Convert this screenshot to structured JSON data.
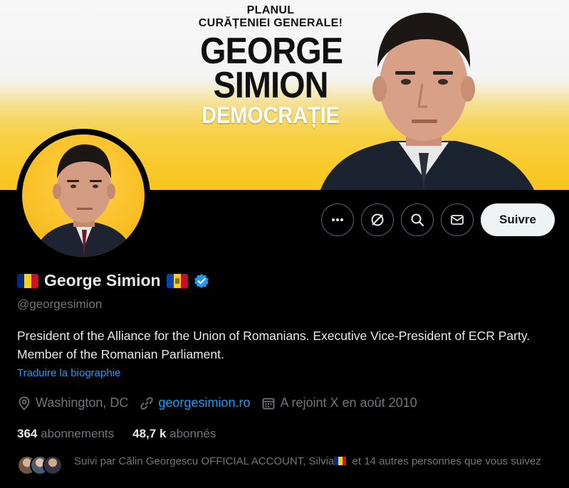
{
  "banner": {
    "line1": "PLANUL",
    "line2": "CURĂȚENIEI GENERALE!",
    "name1": "GEORGE",
    "name2": "SIMION",
    "slogan": "DEMOCRAȚIE"
  },
  "actions": {
    "more_icon": "more-horizontal-icon",
    "grok_icon": "grok-icon",
    "search_icon": "search-icon",
    "message_icon": "envelope-icon",
    "follow_label": "Suivre"
  },
  "profile": {
    "display_name": "George Simion",
    "handle": "@georgesimion",
    "verified": true,
    "bio": "President of the Alliance for the Union of Romanians. Executive Vice-President of ECR Party. Member of the Romanian Parliament.",
    "translate_label": "Traduire la biographie",
    "location": "Washington, DC",
    "website": "georgesimion.ro",
    "joined": "A rejoint X en août 2010",
    "following_count": "364",
    "following_label": "abonnements",
    "followers_count": "48,7 k",
    "followers_label": "abonnés",
    "followed_by_prefix": "Suivi par Călin Georgescu OFFICIAL ACCOUNT, Silvia",
    "followed_by_suffix": " et 14 autres personnes que vous suivez"
  },
  "colors": {
    "accent": "#1d9bf0",
    "banner_yellow": "#f8c51d",
    "muted_text": "#71767b"
  }
}
